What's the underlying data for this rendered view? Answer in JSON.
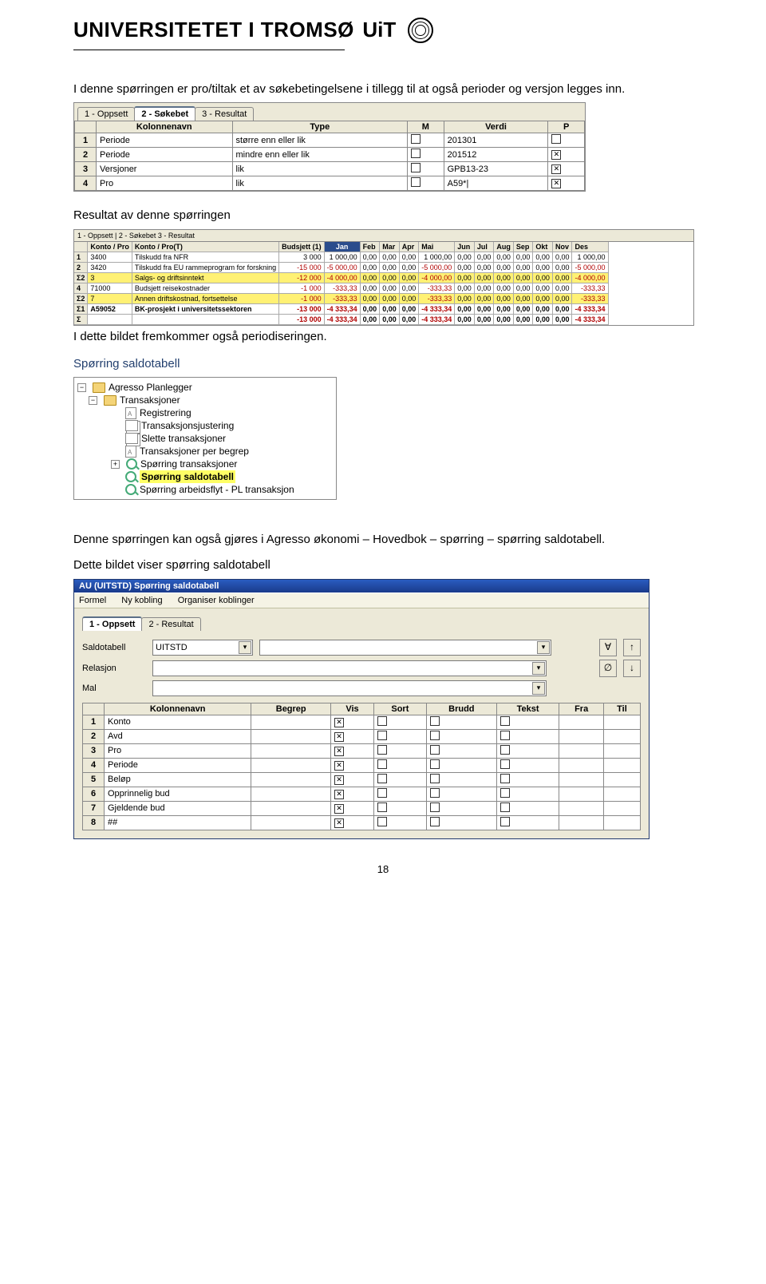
{
  "header": {
    "univ": "UNIVERSITETET I TROMSØ",
    "brand": "UiT"
  },
  "para1": "I denne spørringen er pro/tiltak et av søkebetingelsene i tillegg til at også perioder og versjon legges inn.",
  "query_tabs": [
    "1 - Oppsett",
    "2 - Søkebet",
    "3 - Resultat"
  ],
  "query_cols": [
    "Kolonnenavn",
    "Type",
    "M",
    "Verdi",
    "P"
  ],
  "query_rows": [
    {
      "n": "1",
      "name": "Periode",
      "type": "større enn eller lik",
      "m": false,
      "value": "201301",
      "p": false
    },
    {
      "n": "2",
      "name": "Periode",
      "type": "mindre enn eller lik",
      "m": false,
      "value": "201512",
      "p": true
    },
    {
      "n": "3",
      "name": "Versjoner",
      "type": "lik",
      "m": false,
      "value": "GPB13-23",
      "p": true
    },
    {
      "n": "4",
      "name": "Pro",
      "type": "lik",
      "m": false,
      "value": "A59*|",
      "p": true
    }
  ],
  "para2": "Resultat av denne spørringen",
  "result_tabs": "1 - Oppsett | 2 - Søkebet  3 - Resultat",
  "result_cols": [
    "Konto / Pro",
    "Konto / Pro(T)",
    "Budsjett (1)",
    "Jan",
    "Feb",
    "Mar",
    "Apr",
    "Mai",
    "Jun",
    "Jul",
    "Aug",
    "Sep",
    "Okt",
    "Nov",
    "Des"
  ],
  "result_rows": [
    {
      "cls": "",
      "cells": [
        "1",
        "3400",
        "Tilskudd fra NFR",
        "3 000",
        "1 000,00",
        "0,00",
        "0,00",
        "0,00",
        "1 000,00",
        "0,00",
        "0,00",
        "0,00",
        "0,00",
        "0,00",
        "0,00",
        "1 000,00"
      ]
    },
    {
      "cls": "",
      "cells": [
        "2",
        "3420",
        "Tilskudd fra EU rammeprogram for forskning",
        "-15 000",
        "-5 000,00",
        "0,00",
        "0,00",
        "0,00",
        "-5 000,00",
        "0,00",
        "0,00",
        "0,00",
        "0,00",
        "0,00",
        "0,00",
        "-5 000,00"
      ]
    },
    {
      "cls": "yellowrow",
      "cells": [
        "Σ2",
        "3",
        "Salgs- og driftsinntekt",
        "-12 000",
        "-4 000,00",
        "0,00",
        "0,00",
        "0,00",
        "-4 000,00",
        "0,00",
        "0,00",
        "0,00",
        "0,00",
        "0,00",
        "0,00",
        "-4 000,00"
      ]
    },
    {
      "cls": "",
      "cells": [
        "4",
        "71000",
        "Budsjett reisekostnader",
        "-1 000",
        "-333,33",
        "0,00",
        "0,00",
        "0,00",
        "-333,33",
        "0,00",
        "0,00",
        "0,00",
        "0,00",
        "0,00",
        "0,00",
        "-333,33"
      ]
    },
    {
      "cls": "yellowrow",
      "cells": [
        "Σ2",
        "7",
        "Annen driftskostnad, fortsettelse",
        "-1 000",
        "-333,33",
        "0,00",
        "0,00",
        "0,00",
        "-333,33",
        "0,00",
        "0,00",
        "0,00",
        "0,00",
        "0,00",
        "0,00",
        "-333,33"
      ]
    },
    {
      "cls": "boldrow",
      "cells": [
        "Σ1",
        "A59052",
        "BK-prosjekt i universitetssektoren",
        "-13 000",
        "-4 333,34",
        "0,00",
        "0,00",
        "0,00",
        "-4 333,34",
        "0,00",
        "0,00",
        "0,00",
        "0,00",
        "0,00",
        "0,00",
        "-4 333,34"
      ]
    },
    {
      "cls": "boldrow",
      "cells": [
        "Σ",
        "",
        "",
        "-13 000",
        "-4 333,34",
        "0,00",
        "0,00",
        "0,00",
        "-4 333,34",
        "0,00",
        "0,00",
        "0,00",
        "0,00",
        "0,00",
        "0,00",
        "-4 333,34"
      ]
    }
  ],
  "para3": "I dette bildet fremkommer også periodiseringen.",
  "para4": "Spørring saldotabell",
  "tree": {
    "root": "Agresso Planlegger",
    "sub": "Transaksjoner",
    "items": [
      {
        "icon": "doc",
        "label": "Registrering"
      },
      {
        "icon": "pages",
        "label": "Transaksjonsjustering"
      },
      {
        "icon": "pages",
        "label": "Slette transaksjoner"
      },
      {
        "icon": "doc",
        "label": "Transaksjoner per begrep"
      },
      {
        "icon": "lens",
        "label": "Spørring transaksjoner",
        "expander": "+"
      },
      {
        "icon": "lens",
        "label": "Spørring saldotabell",
        "hilite": true
      },
      {
        "icon": "lens",
        "label": "Spørring arbeidsflyt - PL transaksjon"
      }
    ]
  },
  "para5": "Denne spørringen kan også gjøres i Agresso økonomi – Hovedbok – spørring – spørring saldotabell.",
  "para6": "Dette bildet viser spørring saldotabell",
  "window": {
    "title": "AU (UITSTD) Spørring saldotabell",
    "menu": [
      "Formel",
      "Ny kobling",
      "Organiser koblinger"
    ],
    "tabs": [
      "1 - Oppsett",
      "2 - Resultat"
    ],
    "form": {
      "saldo_label": "Saldotabell",
      "saldo_value": "UITSTD",
      "relasjon_label": "Relasjon",
      "mal_label": "Mal"
    },
    "grid_cols": [
      "Kolonnenavn",
      "Begrep",
      "Vis",
      "Sort",
      "Brudd",
      "Tekst",
      "Fra",
      "Til"
    ],
    "grid_rows": [
      {
        "n": "1",
        "name": "Konto",
        "vis": true
      },
      {
        "n": "2",
        "name": "Avd",
        "vis": true
      },
      {
        "n": "3",
        "name": "Pro",
        "vis": true
      },
      {
        "n": "4",
        "name": "Periode",
        "vis": true
      },
      {
        "n": "5",
        "name": "Beløp",
        "vis": true
      },
      {
        "n": "6",
        "name": "Opprinnelig bud",
        "vis": true
      },
      {
        "n": "7",
        "name": "Gjeldende bud",
        "vis": true
      },
      {
        "n": "8",
        "name": "##",
        "vis": true
      }
    ]
  },
  "page_number": "18"
}
